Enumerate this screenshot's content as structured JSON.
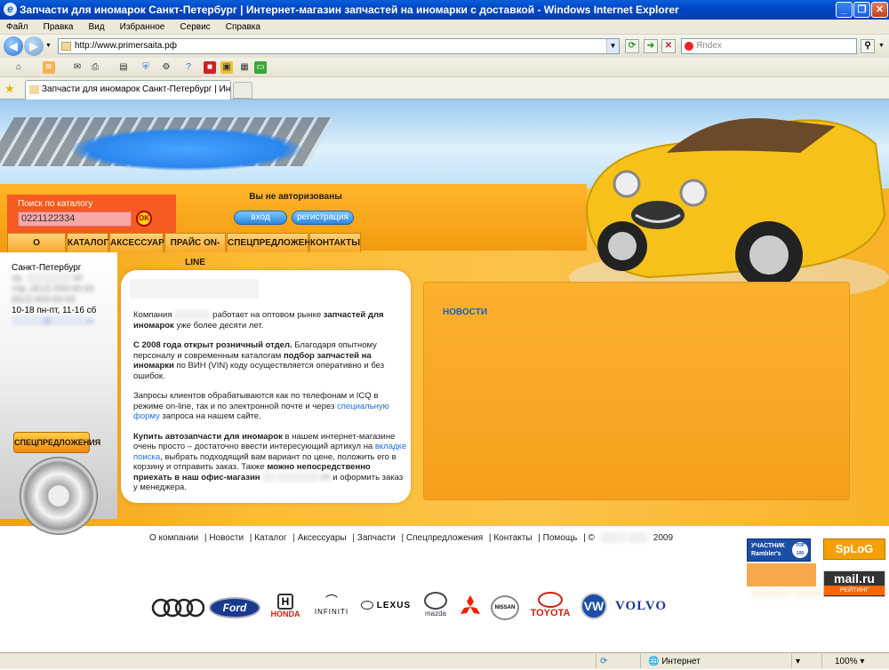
{
  "window": {
    "title": "Запчасти для иномарок Санкт-Петербург | Интернет-магазин запчастей на иномарки с доставкой - Windows Internet Explorer"
  },
  "menu": [
    "Файл",
    "Правка",
    "Вид",
    "Избранное",
    "Сервис",
    "Справка"
  ],
  "address": {
    "url": "http://www.primersaita.рф",
    "search_placeholder": "Яndex"
  },
  "tab": {
    "title": "Запчасти для иномарок Санкт-Петербург | Интерн..."
  },
  "site": {
    "search": {
      "label": "Поиск по каталогу",
      "value": "0221122334",
      "ok": "OK"
    },
    "auth": {
      "status": "Вы не авторизованы",
      "login": "вход",
      "register": "регистрация"
    },
    "nav": [
      "О КОМПАНИИ",
      "КАТАЛОГ",
      "АКСЕССУАРЫ",
      "ПРАЙС ON-LINE",
      "СПЕЦПРЕДЛОЖЕНИЯ",
      "КОНТАКТЫ"
    ],
    "contacts": {
      "city": "Санкт-Петербург",
      "hours": "10-18 пн-пт, 11-16 сб"
    },
    "special_button": "СПЕЦПРЕДЛОЖЕНИЯ",
    "news_title": "НОВОСТИ",
    "intro": {
      "p1_a": "Компания",
      "p1_b": "работает на оптовом рынке",
      "p1_strong": "запчастей для иномарок",
      "p1_c": "уже более десяти лет.",
      "p2_strong": "С 2008 года открыт розничный отдел.",
      "p2_a": "Благодаря опытному персоналу и современным каталогам",
      "p2_strong2": "подбор запчастей на иномарки",
      "p2_b": "по ВИН (VIN) коду осуществляется оперативно и без ошибок.",
      "p3_a": "Запросы клиентов обрабатываются как по телефонам и ICQ в режиме on-line, так и по электронной почте и через",
      "p3_link": "специальную форму",
      "p3_b": "запроса на нашем сайте.",
      "p4_strong": "Купить автозапчасти для иномарок",
      "p4_a": "в нашем интернет-магазине очень просто – достаточно ввести интересующий артикул на",
      "p4_link": "вкладке поиска",
      "p4_b": ", выбрать подходящий вам вариант по цене, положить его в корзину и отправить заказ. Также",
      "p4_strong2": "можно непосредственно приехать в наш офис-магазин",
      "p4_c": "и оформить заказ у менеджера."
    },
    "footer_links": [
      "О компании",
      "Новости",
      "Каталог",
      "Аксессуары",
      "Запчасти",
      "Спецпредложения",
      "Контакты",
      "Помощь"
    ],
    "copyright_prefix": "©",
    "copyright_year": "2009",
    "badges": {
      "rambler_a": "УЧАСТНИК",
      "rambler_b": "Rambler's",
      "rambler_top": "TOP 100",
      "splog": "SpLoG",
      "mail": "mail.ru",
      "mail_sub": "РЕЙТИНГ"
    },
    "brands": [
      "HONDA",
      "INFINITI",
      "LEXUS",
      "mazda",
      "NISSAN",
      "TOYOTA",
      "VOLVO"
    ],
    "brand_ford": "Ford"
  },
  "statusbar": {
    "zone": "Интернет",
    "zoom": "100%"
  }
}
